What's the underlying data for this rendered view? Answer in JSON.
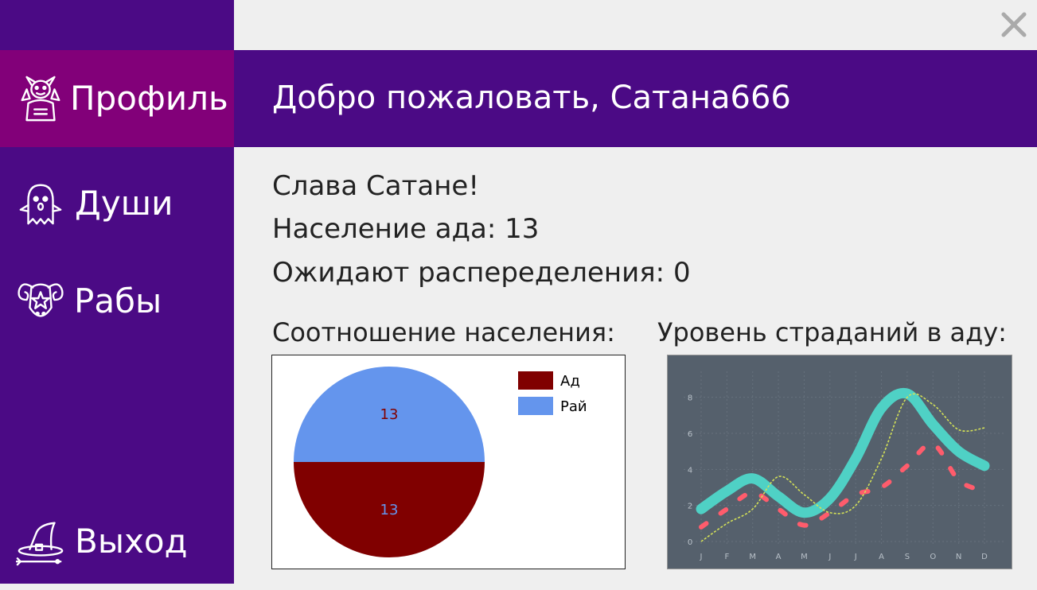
{
  "sidebar": {
    "items": [
      {
        "label": "Профиль",
        "icon": "devil-icon",
        "active": true
      },
      {
        "label": "Души",
        "icon": "ghost-icon",
        "active": false
      },
      {
        "label": "Рабы",
        "icon": "ram-skull-icon",
        "active": false
      },
      {
        "label": "Выход",
        "icon": "witch-hat-icon",
        "active": false
      }
    ]
  },
  "topbar": {
    "close_icon": "close-icon"
  },
  "header": {
    "welcome": "Добро пожаловать, Сатана666"
  },
  "main": {
    "motto": "Слава Сатане!",
    "population": "Население ада: 13",
    "waiting": "Ожидают распеределения: 0",
    "pie_title": "Соотношение населения:",
    "line_title": "Уровень страданий в аду:"
  },
  "colors": {
    "sidebar": "#4b0a85",
    "active": "#820079",
    "hell": "#800000",
    "heaven": "#6495ed",
    "line_bg": "#55606c",
    "teal": "#4fd1c5",
    "dashed_red": "#ff5c6c",
    "dotted_yellow": "#d4e157"
  },
  "chart_data": [
    {
      "type": "pie",
      "title": "Соотношение населения:",
      "labels": [
        "Ад",
        "Рай"
      ],
      "values": [
        13,
        13
      ],
      "slice_labels": [
        "13",
        "13"
      ],
      "legend": "top-right"
    },
    {
      "type": "line",
      "title": "Уровень страданий в аду:",
      "categories": [
        "J",
        "F",
        "M",
        "A",
        "M",
        "J",
        "J",
        "A",
        "S",
        "O",
        "N",
        "D"
      ],
      "yticks": [
        "0",
        "2",
        "4",
        "6",
        "8"
      ],
      "ylim": [
        0,
        9
      ],
      "grid": true,
      "series": [
        {
          "style": "thick-teal",
          "values": [
            1.8,
            2.8,
            3.5,
            2.5,
            1.6,
            2.4,
            4.6,
            7.4,
            8.2,
            6.5,
            5.0,
            4.2
          ]
        },
        {
          "style": "dashed-red",
          "values": [
            0.8,
            1.8,
            2.7,
            1.8,
            0.9,
            1.6,
            2.6,
            3.0,
            4.2,
            5.4,
            3.4,
            2.8
          ]
        },
        {
          "style": "dotted-yellow",
          "values": [
            0.0,
            1.0,
            1.8,
            3.6,
            2.6,
            1.6,
            2.0,
            4.6,
            8.0,
            7.6,
            6.2,
            6.3
          ]
        }
      ]
    }
  ]
}
